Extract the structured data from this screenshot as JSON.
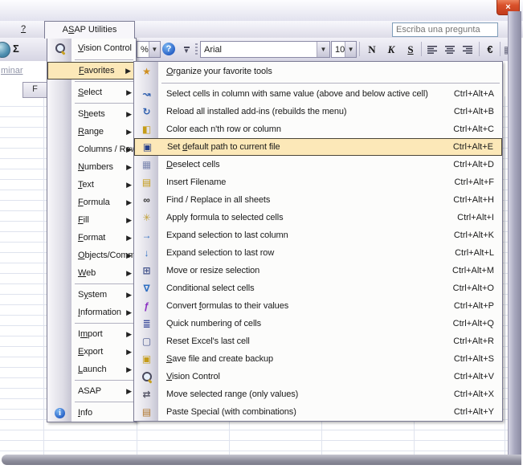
{
  "titlebar": {
    "close_label": "×"
  },
  "menubar": {
    "help_label": "?",
    "asap_tab": {
      "label": "ASAP Utilities",
      "accel": 1
    },
    "question_box_placeholder": "Escriba una pregunta"
  },
  "toolbar": {
    "sigma_label": "Σ",
    "zoom_suffix": "%",
    "font_name": "Arial",
    "font_size": "10",
    "bold_label": "N",
    "italic_label": "K",
    "underline_label": "S",
    "euro_label": "€"
  },
  "sheet": {
    "clipped_text": "minar",
    "column_header": "F"
  },
  "colors": {
    "highlight_bg": "#fce8b8",
    "highlight_border": "#4a4538",
    "accent_blue": "#2e6fc2",
    "menu_border": "#7c7c94"
  },
  "main_menu": {
    "items": [
      {
        "label": "Vision Control",
        "accel": 0,
        "icon": "magnifier",
        "submenu": false,
        "tall": true,
        "separator_after": true
      },
      {
        "label": "Favorites",
        "accel": 0,
        "submenu": true,
        "selected": true,
        "separator_after": true
      },
      {
        "label": "Select",
        "accel": 0,
        "submenu": true,
        "separator_after": true
      },
      {
        "label": "Sheets",
        "accel": 1,
        "submenu": true
      },
      {
        "label": "Range",
        "accel": 0,
        "submenu": true
      },
      {
        "label": "Columns / Rows",
        "accel": -1,
        "submenu": true
      },
      {
        "label": "Numbers",
        "accel": 0,
        "submenu": true
      },
      {
        "label": "Text",
        "accel": 0,
        "submenu": true
      },
      {
        "label": "Formula",
        "accel": 0,
        "submenu": true
      },
      {
        "label": "Fill",
        "accel": 0,
        "submenu": true
      },
      {
        "label": "Format",
        "accel": 0,
        "submenu": true
      },
      {
        "label": "Objects/Comments",
        "accel": 0,
        "submenu": true
      },
      {
        "label": "Web",
        "accel": 0,
        "submenu": true,
        "separator_after": true
      },
      {
        "label": "System",
        "accel": 1,
        "submenu": true
      },
      {
        "label": "Information",
        "accel": 0,
        "submenu": true,
        "separator_after": true
      },
      {
        "label": "Import",
        "accel": 1,
        "submenu": true
      },
      {
        "label": "Export",
        "accel": 0,
        "submenu": true
      },
      {
        "label": "Launch",
        "accel": 0,
        "submenu": true,
        "separator_after": true
      },
      {
        "label": "ASAP",
        "accel": -1,
        "submenu": true,
        "separator_after": true
      },
      {
        "label": "Info",
        "accel": 0,
        "icon": "info",
        "submenu": false
      }
    ]
  },
  "favorites_submenu": {
    "items": [
      {
        "label": "Organize your favorite tools",
        "accel": 0,
        "shortcut": "",
        "icon": "organize-favorites",
        "tall": true,
        "separator_after": true
      },
      {
        "label": "Select cells in column with same value (above and below active cell)",
        "accel": -1,
        "shortcut": "Ctrl+Alt+A",
        "icon": "select-same-value"
      },
      {
        "label": "Reload all installed add-ins (rebuilds the menu)",
        "accel": -1,
        "shortcut": "Ctrl+Alt+B",
        "icon": "reload-addins"
      },
      {
        "label": "Color each n'th row or column",
        "accel": -1,
        "shortcut": "Ctrl+Alt+C",
        "icon": "color-nth-row"
      },
      {
        "label": "Set default path to current file",
        "accel": 4,
        "shortcut": "Ctrl+Alt+E",
        "icon": "set-default-path",
        "selected": true
      },
      {
        "label": "Deselect cells",
        "accel": 0,
        "shortcut": "Ctrl+Alt+D",
        "icon": "deselect-cells"
      },
      {
        "label": "Insert Filename",
        "accel": -1,
        "shortcut": "Ctrl+Alt+F",
        "icon": "insert-filename"
      },
      {
        "label": "Find / Replace in all sheets",
        "accel": -1,
        "shortcut": "Ctrl+Alt+H",
        "icon": "find-replace"
      },
      {
        "label": "Apply formula to selected cells",
        "accel": -1,
        "shortcut": "Ctrl+Alt+I",
        "icon": "apply-formula"
      },
      {
        "label": "Expand selection to last column",
        "accel": -1,
        "shortcut": "Ctrl+Alt+K",
        "icon": "expand-last-column"
      },
      {
        "label": "Expand selection to last row",
        "accel": -1,
        "shortcut": "Ctrl+Alt+L",
        "icon": "expand-last-row"
      },
      {
        "label": "Move or resize selection",
        "accel": -1,
        "shortcut": "Ctrl+Alt+M",
        "icon": "move-resize-selection"
      },
      {
        "label": "Conditional select cells",
        "accel": -1,
        "shortcut": "Ctrl+Alt+O",
        "icon": "conditional-select"
      },
      {
        "label": "Convert formulas to their values",
        "accel": 8,
        "shortcut": "Ctrl+Alt+P",
        "icon": "convert-formulas"
      },
      {
        "label": "Quick numbering of cells",
        "accel": -1,
        "shortcut": "Ctrl+Alt+Q",
        "icon": "quick-numbering"
      },
      {
        "label": "Reset Excel's last cell",
        "accel": -1,
        "shortcut": "Ctrl+Alt+R",
        "icon": "reset-last-cell"
      },
      {
        "label": "Save file and create backup",
        "accel": 0,
        "shortcut": "Ctrl+Alt+S",
        "icon": "save-backup"
      },
      {
        "label": "Vision Control",
        "accel": 0,
        "shortcut": "Ctrl+Alt+V",
        "icon": "vision-control"
      },
      {
        "label": "Move selected range (only values)",
        "accel": -1,
        "shortcut": "Ctrl+Alt+X",
        "icon": "move-range-values"
      },
      {
        "label": "Paste Special (with combinations)",
        "accel": -1,
        "shortcut": "Ctrl+Alt+Y",
        "icon": "paste-special"
      }
    ]
  }
}
